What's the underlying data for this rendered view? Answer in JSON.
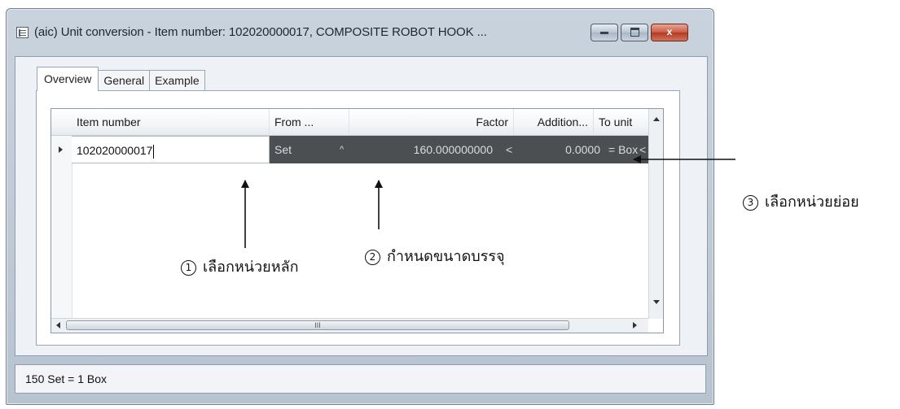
{
  "window": {
    "title": "(aic) Unit conversion - Item number: 102020000017, COMPOSITE ROBOT HOOK ...",
    "buttons": {
      "minimize": "",
      "maximize": "",
      "close": "x"
    }
  },
  "tabs": [
    "Overview",
    "General",
    "Example"
  ],
  "grid": {
    "columns": [
      "Item number",
      "From ...",
      "Factor",
      "Addition...",
      "To unit"
    ],
    "row": {
      "item_number": "102020000017",
      "from_unit": "Set",
      "from_dropdown": "^",
      "factor": "160.000000000",
      "times_sign": "<",
      "addition": "0.0000",
      "equals_to": "= Box",
      "to_dropdown": "<"
    },
    "hscroll_thumb": "III"
  },
  "status": {
    "text": "150 Set = 1 Box"
  },
  "annotations": {
    "a1": {
      "num": "1",
      "text": "เลือกหน่วยหลัก"
    },
    "a2": {
      "num": "2",
      "text": "กำหนดขนาดบรรจุ"
    },
    "a3": {
      "num": "3",
      "text": "เลือกหน่วยย่อย"
    }
  }
}
